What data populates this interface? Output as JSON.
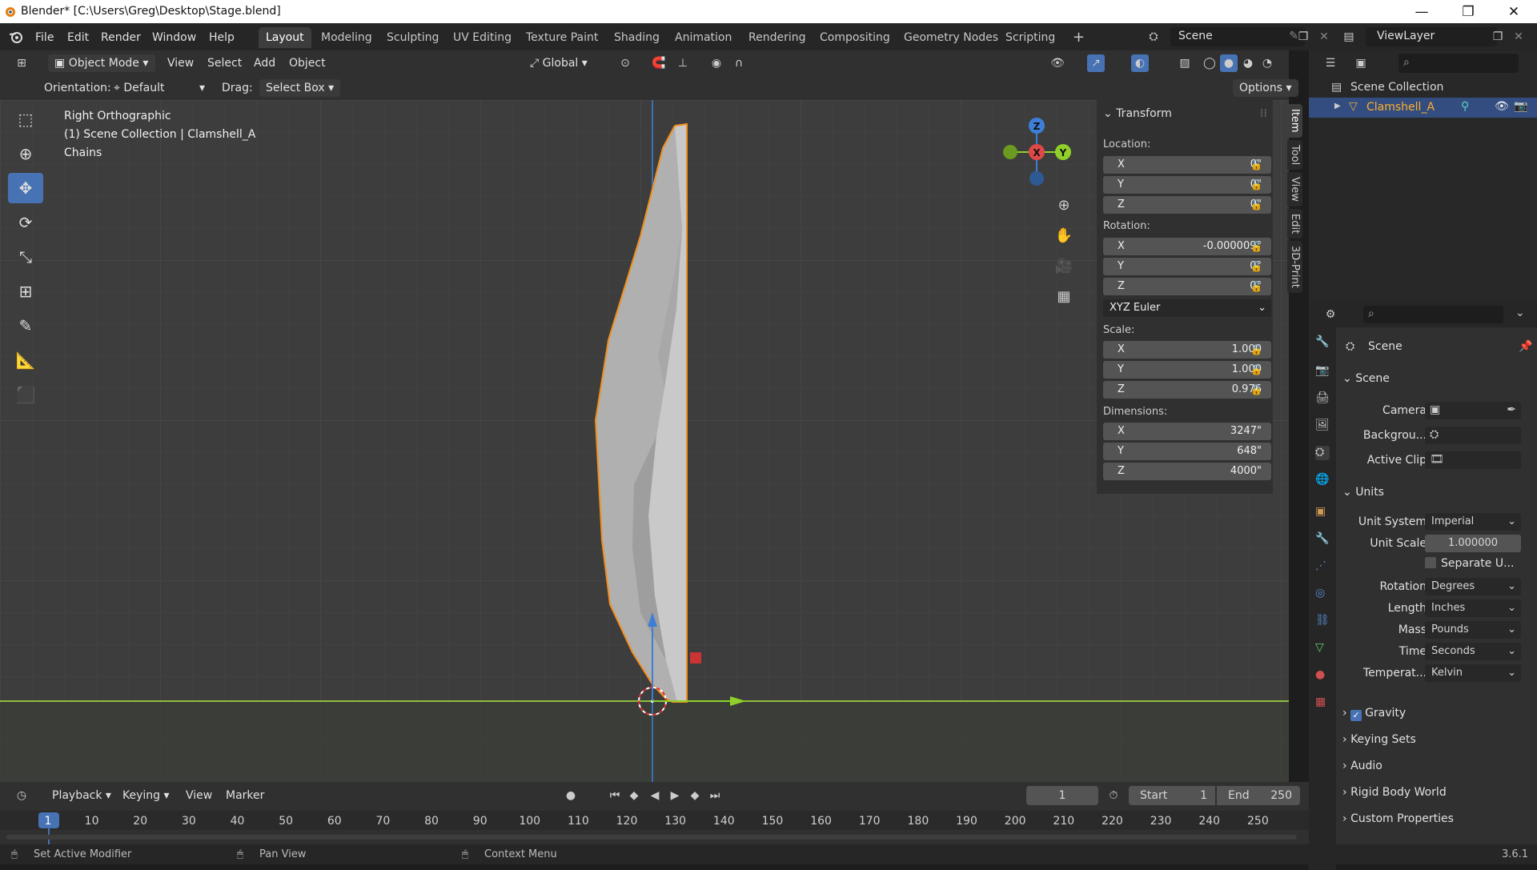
{
  "window": {
    "title": "Blender* [C:\\Users\\Greg\\Desktop\\Stage.blend]",
    "minimize": "—",
    "maximize": "❐",
    "close": "✕"
  },
  "menus": [
    "File",
    "Edit",
    "Render",
    "Window",
    "Help"
  ],
  "workspaces": [
    "Layout",
    "Modeling",
    "Sculpting",
    "UV Editing",
    "Texture Paint",
    "Shading",
    "Animation",
    "Rendering",
    "Compositing",
    "Geometry Nodes",
    "Scripting"
  ],
  "active_workspace": "Layout",
  "add_workspace": "+",
  "scene_selector": "Scene",
  "view_layer": "ViewLayer",
  "header": {
    "mode": "Object Mode",
    "view": "View",
    "select": "Select",
    "add": "Add",
    "object": "Object",
    "transform_orientation": "Global"
  },
  "tool_settings": {
    "orientation_label": "Orientation:",
    "orientation": "Default",
    "drag_label": "Drag:",
    "drag": "Select Box",
    "options": "Options"
  },
  "viewport": {
    "view_name": "Right Orthographic",
    "collection": "(1) Scene Collection | Clamshell_A",
    "object": "Chains"
  },
  "gizmo": {
    "z": "Z",
    "y": "Y",
    "x": "X"
  },
  "n_panel": {
    "title": "Transform",
    "location_label": "Location:",
    "location": [
      {
        "axis": "X",
        "value": "0\""
      },
      {
        "axis": "Y",
        "value": "0\""
      },
      {
        "axis": "Z",
        "value": "0\""
      }
    ],
    "rotation_label": "Rotation:",
    "rotation": [
      {
        "axis": "X",
        "value": "-0.000009°"
      },
      {
        "axis": "Y",
        "value": "0°"
      },
      {
        "axis": "Z",
        "value": "0°"
      }
    ],
    "rotation_mode": "XYZ Euler",
    "scale_label": "Scale:",
    "scale": [
      {
        "axis": "X",
        "value": "1.000"
      },
      {
        "axis": "Y",
        "value": "1.000"
      },
      {
        "axis": "Z",
        "value": "0.976"
      }
    ],
    "dimensions_label": "Dimensions:",
    "dimensions": [
      {
        "axis": "X",
        "value": "3247\""
      },
      {
        "axis": "Y",
        "value": "648\""
      },
      {
        "axis": "Z",
        "value": "4000\""
      }
    ],
    "tabs": [
      "Item",
      "Tool",
      "View",
      "Edit",
      "3D-Print"
    ]
  },
  "outliner": {
    "root": "Scene Collection",
    "item": "Clamshell_A"
  },
  "properties": {
    "context": "Scene",
    "scene_section": "Scene",
    "camera_label": "Camera",
    "background_label": "Backgrou...",
    "active_clip_label": "Active Clip",
    "units_section": "Units",
    "units": [
      {
        "label": "Unit System",
        "value": "Imperial"
      },
      {
        "label": "Unit Scale",
        "value": "1.000000"
      }
    ],
    "separate_units": "Separate U...",
    "units2": [
      {
        "label": "Rotation",
        "value": "Degrees"
      },
      {
        "label": "Length",
        "value": "Inches"
      },
      {
        "label": "Mass",
        "value": "Pounds"
      },
      {
        "label": "Time",
        "value": "Seconds"
      },
      {
        "label": "Temperat...",
        "value": "Kelvin"
      }
    ],
    "collapsed": [
      "Gravity",
      "Keying Sets",
      "Audio",
      "Rigid Body World",
      "Custom Properties"
    ]
  },
  "timeline": {
    "playback": "Playback",
    "keying": "Keying",
    "view": "View",
    "marker": "Marker",
    "current_frame": "1",
    "start_label": "Start",
    "start": "1",
    "end_label": "End",
    "end": "250",
    "ticks": [
      "1",
      "10",
      "20",
      "30",
      "40",
      "50",
      "60",
      "70",
      "80",
      "90",
      "100",
      "110",
      "120",
      "130",
      "140",
      "150",
      "160",
      "170",
      "180",
      "190",
      "200",
      "210",
      "220",
      "230",
      "240",
      "250"
    ]
  },
  "status": {
    "left": "Set Active Modifier",
    "middle": "Pan View",
    "right": "Context Menu",
    "version": "3.6.1"
  }
}
